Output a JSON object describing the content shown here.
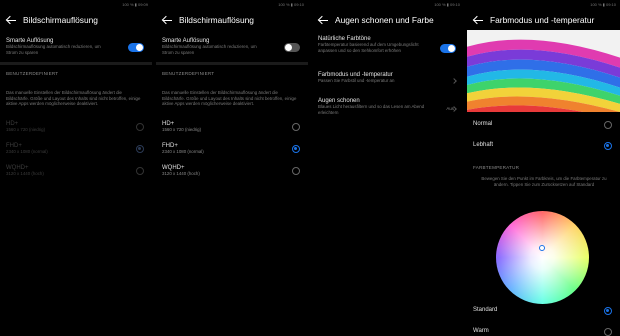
{
  "statusbar": {
    "left": "",
    "screens": [
      {
        "right": "100 % ▮ 09:09"
      },
      {
        "right": "100 % ▮ 09:10"
      },
      {
        "right": "100 % ▮ 09:10"
      },
      {
        "right": "100 % ▮ 09:10"
      }
    ]
  },
  "screen1": {
    "title": "Bildschirmauflösung",
    "smart_title": "Smarte Auflösung",
    "smart_sub": "Bildschirmauflösung automatisch reduzieren, um Strom zu sparen",
    "smart_toggle": "on",
    "section": "BENUTZERDEFINIERT",
    "desc": "Das manuelle Einstellen der Bildschirmauflösung ändert die Bildschärfe. Größe und Layout des Inhalts sind nicht betroffen, einige aktive Apps werden möglicherweise deaktiviert.",
    "options": [
      {
        "label": "HD+",
        "sub": "1560 x 720 (niedrig)"
      },
      {
        "label": "FHD+",
        "sub": "2340 x 1080 (normal)"
      },
      {
        "label": "WQHD+",
        "sub": "3120 x 1440 (hoch)"
      }
    ],
    "selected_index": 1
  },
  "screen2": {
    "title": "Bildschirmauflösung",
    "smart_title": "Smarte Auflösung",
    "smart_sub": "Bildschirmauflösung automatisch reduzieren, um Strom zu sparen",
    "smart_toggle": "off",
    "section": "BENUTZERDEFINIERT",
    "desc": "Das manuelle Einstellen der Bildschirmauflösung ändert die Bildschärfe. Größe und Layout des Inhalts sind nicht betroffen, einige aktive Apps werden möglicherweise deaktiviert.",
    "options": [
      {
        "label": "HD+",
        "sub": "1560 x 720 (niedrig)"
      },
      {
        "label": "FHD+",
        "sub": "2340 x 1080 (normal)"
      },
      {
        "label": "WQHD+",
        "sub": "3120 x 1440 (hoch)"
      }
    ],
    "selected_index": 1
  },
  "screen3": {
    "title": "Augen schonen und Farbe",
    "natural_title": "Natürliche Farbtöne",
    "natural_sub": "Farbtemperatur basierend auf dem Umgebungslicht anpassen und so den Sehkomfort erhöhen",
    "natural_toggle": "on",
    "colormode_title": "Farbmodus und -temperatur",
    "colormode_sub": "Passen Sie Farbstil und -temperatur an",
    "eyes_title": "Augen schonen",
    "eyes_sub": "Blaues Licht herausfiltern und so das Lesen am Abend erleichtern",
    "eyes_value": "Aus"
  },
  "screen4": {
    "title": "Farbmodus und -temperatur",
    "modes": [
      "Normal",
      "Lebhaft"
    ],
    "selected_mode": 1,
    "section": "FARBTEMPERATUR",
    "desc": "Bewegen Sie den Punkt im Farbkreis, um die Farbtemperatur zu ändern. Tippen Sie zum Zurücksetzen auf Standard",
    "temps": [
      "Standard",
      "Warm"
    ],
    "selected_temp": 0
  },
  "colors": {
    "accent": "#1a73e8",
    "background": "#000000"
  }
}
